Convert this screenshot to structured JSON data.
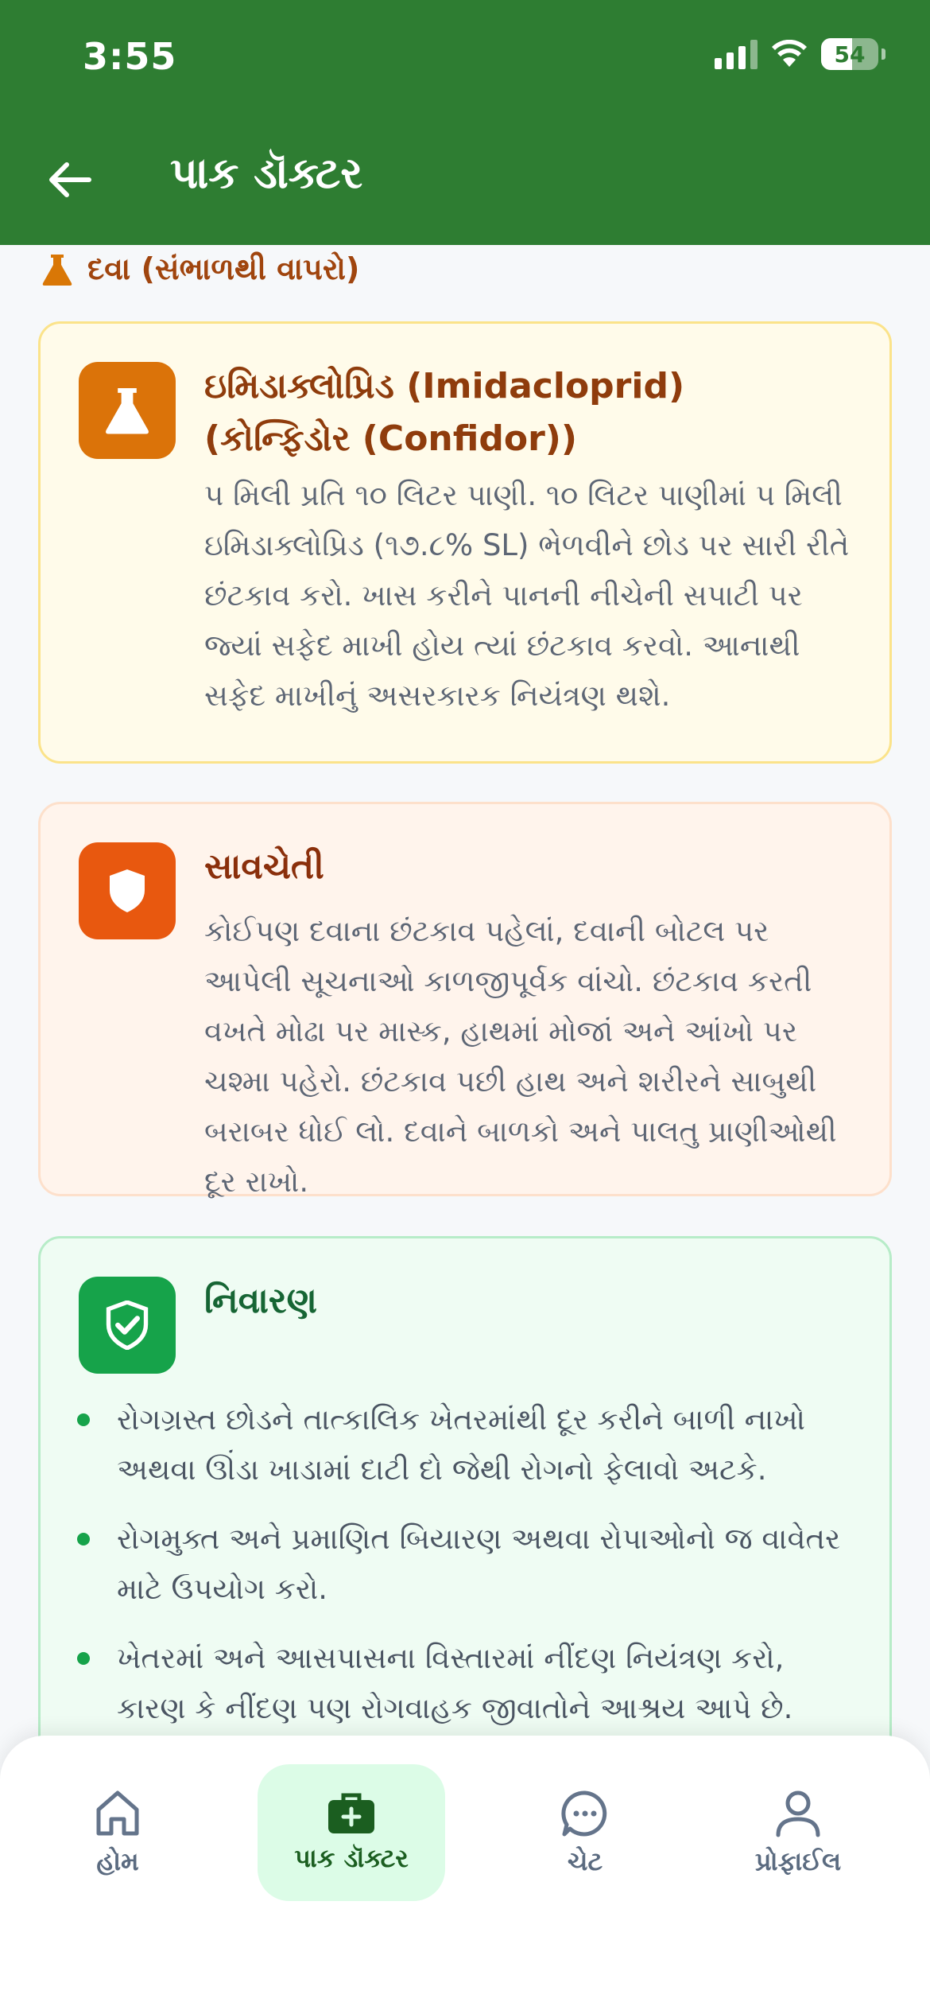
{
  "status_bar": {
    "time": "3:55",
    "battery_level": "54",
    "battery_fraction": 0.54
  },
  "header": {
    "title": "પાક ડૉક્ટર",
    "back_icon": "arrow-left-icon"
  },
  "section": {
    "label": "દવા (સંભાળથી વાપરો)",
    "icon": "flask-icon",
    "color": "#d97706"
  },
  "medicine_card": {
    "icon": "flask-icon",
    "title": "ઇમિડાક્લોપ્રિડ (Imidacloprid) (કોન્ફિડોર (Confidor))",
    "body": "૫ મિલી પ્રતિ ૧૦ લિટર પાણી. ૧૦ લિટર પાણીમાં ૫ મિલી ઇમિડાક્લોપ્રિડ (૧૭.૮% SL) ભેળવીને છોડ પર સારી રીતે છંટકાવ કરો. ખાસ કરીને પાનની નીચેની સપાટી પર જ્યાં સફેદ માખી હોય ત્યાં છંટકાવ કરવો. આનાથી સફેદ માખીનું અસરકારક નિયંત્રણ થશે."
  },
  "caution_card": {
    "icon": "shield-icon",
    "title": "સાવચેતી",
    "body": "કોઈપણ દવાના છંટકાવ પહેલાં, દવાની બોટલ પર આપેલી સૂચનાઓ કાળજીપૂર્વક વાંચો. છંટકાવ કરતી વખતે મોઢા પર માસ્ક, હાથમાં મોજાં અને આંખો પર ચશ્મા પહેરો. છંટકાવ પછી હાથ અને શરીરને સાબુથી બરાબર ધોઈ લો. દવાને બાળકો અને પાલતુ પ્રાણીઓથી દૂર રાખો."
  },
  "prevention_card": {
    "icon": "shield-check-icon",
    "title": "નિવારણ",
    "items": [
      "રોગગ્રસ્ત છોડને તાત્કાલિક ખેતરમાંથી દૂર કરીને બાળી નાખો અથવા ઊંડા ખાડામાં દાટી દો જેથી રોગનો ફેલાવો અટકે.",
      "રોગમુક્ત અને પ્રમાણિત બિયારણ અથવા રોપાઓનો જ વાવેતર માટે ઉપયોગ કરો.",
      "ખેતરમાં અને આસપાસના વિસ્તારમાં નીંદણ નિયંત્રણ કરો, કારણ કે નીંદણ પણ રોગવાહક જીવાતોને આશ્રય આપે છે."
    ]
  },
  "bottom_nav": {
    "items": [
      {
        "label": "હોમ",
        "icon": "home-icon"
      },
      {
        "label": "પાક ડૉક્ટર",
        "icon": "medical-kit-icon",
        "active": true
      },
      {
        "label": "ચેટ",
        "icon": "chat-bubble-icon"
      },
      {
        "label": "પ્રોફાઈલ",
        "icon": "user-icon"
      }
    ]
  }
}
